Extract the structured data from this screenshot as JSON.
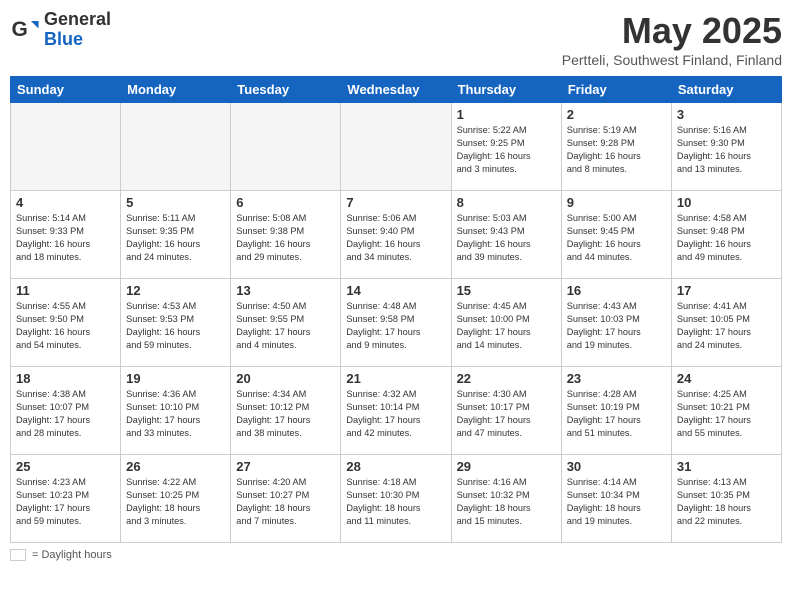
{
  "header": {
    "logo_general": "General",
    "logo_blue": "Blue",
    "month": "May 2025",
    "location": "Pertteli, Southwest Finland, Finland"
  },
  "weekdays": [
    "Sunday",
    "Monday",
    "Tuesday",
    "Wednesday",
    "Thursday",
    "Friday",
    "Saturday"
  ],
  "weeks": [
    [
      {
        "day": "",
        "info": ""
      },
      {
        "day": "",
        "info": ""
      },
      {
        "day": "",
        "info": ""
      },
      {
        "day": "",
        "info": ""
      },
      {
        "day": "1",
        "info": "Sunrise: 5:22 AM\nSunset: 9:25 PM\nDaylight: 16 hours\nand 3 minutes."
      },
      {
        "day": "2",
        "info": "Sunrise: 5:19 AM\nSunset: 9:28 PM\nDaylight: 16 hours\nand 8 minutes."
      },
      {
        "day": "3",
        "info": "Sunrise: 5:16 AM\nSunset: 9:30 PM\nDaylight: 16 hours\nand 13 minutes."
      }
    ],
    [
      {
        "day": "4",
        "info": "Sunrise: 5:14 AM\nSunset: 9:33 PM\nDaylight: 16 hours\nand 18 minutes."
      },
      {
        "day": "5",
        "info": "Sunrise: 5:11 AM\nSunset: 9:35 PM\nDaylight: 16 hours\nand 24 minutes."
      },
      {
        "day": "6",
        "info": "Sunrise: 5:08 AM\nSunset: 9:38 PM\nDaylight: 16 hours\nand 29 minutes."
      },
      {
        "day": "7",
        "info": "Sunrise: 5:06 AM\nSunset: 9:40 PM\nDaylight: 16 hours\nand 34 minutes."
      },
      {
        "day": "8",
        "info": "Sunrise: 5:03 AM\nSunset: 9:43 PM\nDaylight: 16 hours\nand 39 minutes."
      },
      {
        "day": "9",
        "info": "Sunrise: 5:00 AM\nSunset: 9:45 PM\nDaylight: 16 hours\nand 44 minutes."
      },
      {
        "day": "10",
        "info": "Sunrise: 4:58 AM\nSunset: 9:48 PM\nDaylight: 16 hours\nand 49 minutes."
      }
    ],
    [
      {
        "day": "11",
        "info": "Sunrise: 4:55 AM\nSunset: 9:50 PM\nDaylight: 16 hours\nand 54 minutes."
      },
      {
        "day": "12",
        "info": "Sunrise: 4:53 AM\nSunset: 9:53 PM\nDaylight: 16 hours\nand 59 minutes."
      },
      {
        "day": "13",
        "info": "Sunrise: 4:50 AM\nSunset: 9:55 PM\nDaylight: 17 hours\nand 4 minutes."
      },
      {
        "day": "14",
        "info": "Sunrise: 4:48 AM\nSunset: 9:58 PM\nDaylight: 17 hours\nand 9 minutes."
      },
      {
        "day": "15",
        "info": "Sunrise: 4:45 AM\nSunset: 10:00 PM\nDaylight: 17 hours\nand 14 minutes."
      },
      {
        "day": "16",
        "info": "Sunrise: 4:43 AM\nSunset: 10:03 PM\nDaylight: 17 hours\nand 19 minutes."
      },
      {
        "day": "17",
        "info": "Sunrise: 4:41 AM\nSunset: 10:05 PM\nDaylight: 17 hours\nand 24 minutes."
      }
    ],
    [
      {
        "day": "18",
        "info": "Sunrise: 4:38 AM\nSunset: 10:07 PM\nDaylight: 17 hours\nand 28 minutes."
      },
      {
        "day": "19",
        "info": "Sunrise: 4:36 AM\nSunset: 10:10 PM\nDaylight: 17 hours\nand 33 minutes."
      },
      {
        "day": "20",
        "info": "Sunrise: 4:34 AM\nSunset: 10:12 PM\nDaylight: 17 hours\nand 38 minutes."
      },
      {
        "day": "21",
        "info": "Sunrise: 4:32 AM\nSunset: 10:14 PM\nDaylight: 17 hours\nand 42 minutes."
      },
      {
        "day": "22",
        "info": "Sunrise: 4:30 AM\nSunset: 10:17 PM\nDaylight: 17 hours\nand 47 minutes."
      },
      {
        "day": "23",
        "info": "Sunrise: 4:28 AM\nSunset: 10:19 PM\nDaylight: 17 hours\nand 51 minutes."
      },
      {
        "day": "24",
        "info": "Sunrise: 4:25 AM\nSunset: 10:21 PM\nDaylight: 17 hours\nand 55 minutes."
      }
    ],
    [
      {
        "day": "25",
        "info": "Sunrise: 4:23 AM\nSunset: 10:23 PM\nDaylight: 17 hours\nand 59 minutes."
      },
      {
        "day": "26",
        "info": "Sunrise: 4:22 AM\nSunset: 10:25 PM\nDaylight: 18 hours\nand 3 minutes."
      },
      {
        "day": "27",
        "info": "Sunrise: 4:20 AM\nSunset: 10:27 PM\nDaylight: 18 hours\nand 7 minutes."
      },
      {
        "day": "28",
        "info": "Sunrise: 4:18 AM\nSunset: 10:30 PM\nDaylight: 18 hours\nand 11 minutes."
      },
      {
        "day": "29",
        "info": "Sunrise: 4:16 AM\nSunset: 10:32 PM\nDaylight: 18 hours\nand 15 minutes."
      },
      {
        "day": "30",
        "info": "Sunrise: 4:14 AM\nSunset: 10:34 PM\nDaylight: 18 hours\nand 19 minutes."
      },
      {
        "day": "31",
        "info": "Sunrise: 4:13 AM\nSunset: 10:35 PM\nDaylight: 18 hours\nand 22 minutes."
      }
    ]
  ],
  "legend": {
    "box_label": "= Daylight hours"
  }
}
